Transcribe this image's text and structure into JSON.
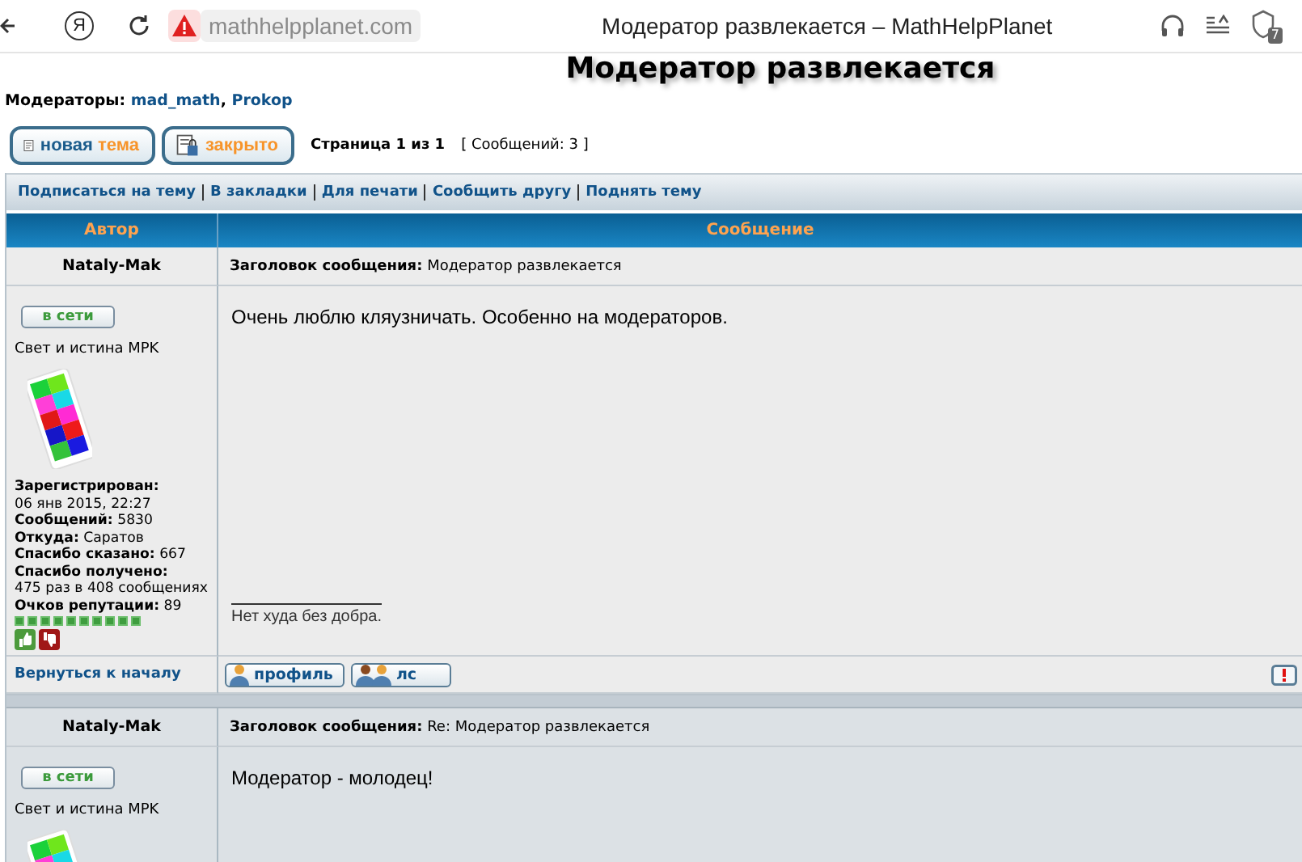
{
  "browser": {
    "logo": "Я",
    "address": "mathhelpplanet.com",
    "tab_title": "Модератор развлекается – MathHelpPlanet",
    "badge": "7"
  },
  "page_title": "Модератор развлекается",
  "moderators": {
    "label": "Модераторы:",
    "names": [
      "mad_math",
      "Prokop"
    ],
    "separator": ","
  },
  "action_buttons": [
    {
      "kind": "new-topic",
      "words": [
        "новая",
        "тема"
      ]
    },
    {
      "kind": "locked",
      "words": [
        "закрыто"
      ]
    }
  ],
  "pagination": {
    "pages": "Страница 1 из 1",
    "count": "[ Сообщений: 3 ]"
  },
  "topic_links": [
    "Подписаться на тему",
    "В закладки",
    "Для печати",
    "Сообщить другу",
    "Поднять тему"
  ],
  "columns": [
    "Автор",
    "Сообщение"
  ],
  "posts": [
    {
      "author": "Nataly-Mak",
      "status": "в сети",
      "rank": "Свет и истина MPK",
      "subject_label": "Заголовок сообщения:",
      "subject": "Модератор развлекается",
      "message": "Очень люблю кляузничать. Особенно на модераторов.",
      "signature": "Нет худа без добра.",
      "profile": [
        {
          "kind": "stacked",
          "text": "**Зарегистрирован:** 06 янв 2015, 22:27"
        },
        {
          "kind": "inline",
          "text": "**Сообщений:** 5830"
        },
        {
          "kind": "inline",
          "text": "**Откуда:** Саратов"
        },
        {
          "kind": "inline",
          "text": "**Спасибо сказано:** 667"
        },
        {
          "kind": "stacked",
          "text": "**Спасибо получено:** 475 раз в 408 сообщениях"
        },
        {
          "kind": "inline",
          "text": "**Очков репутации:** 89"
        }
      ],
      "stars": 10,
      "back_link": "Вернуться к началу",
      "buttons": [
        {
          "kind": "profile",
          "label": "профиль"
        },
        {
          "kind": "pm",
          "label": "лс"
        }
      ]
    },
    {
      "author": "Nataly-Mak",
      "status": "в сети",
      "rank": "Свет и истина MPK",
      "subject_label": "Заголовок сообщения:",
      "subject": "Re: Модератор развлекается",
      "message": "Модератор - молодец!"
    }
  ]
}
